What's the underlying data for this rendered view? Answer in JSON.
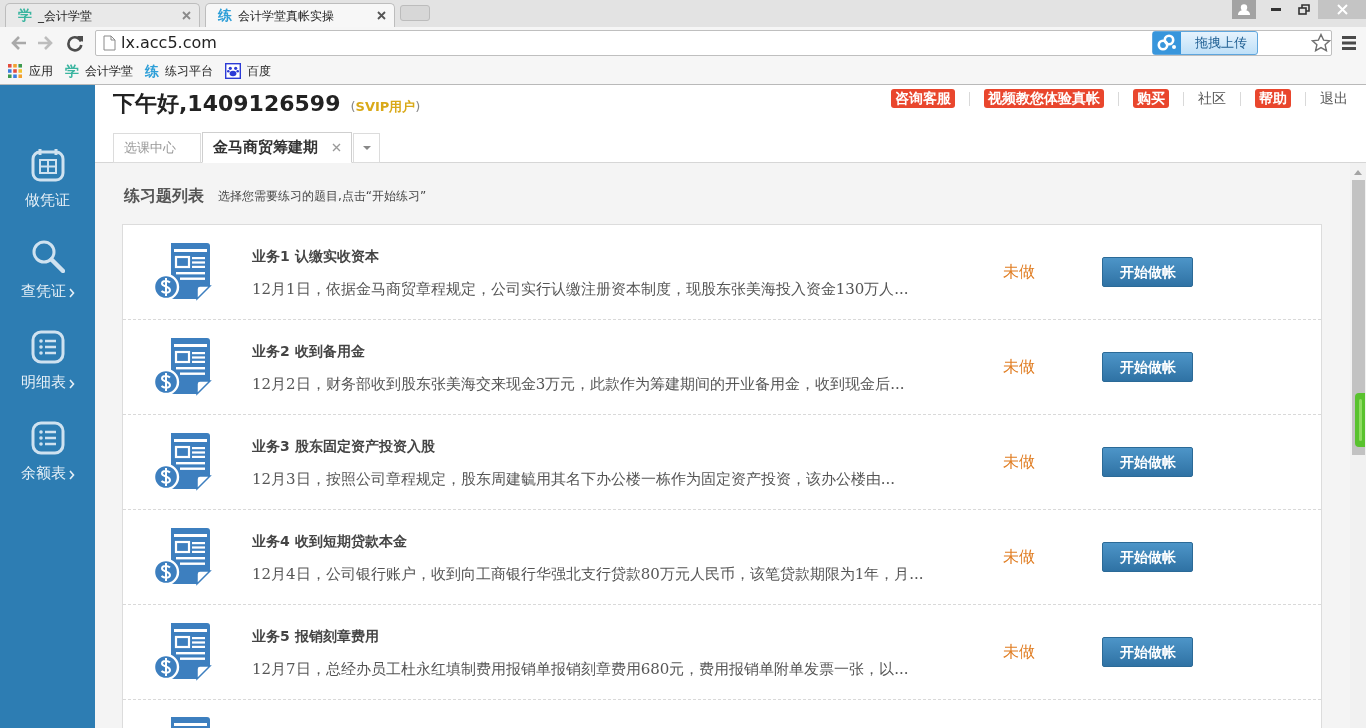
{
  "browser": {
    "tabs": [
      {
        "favicon": "学",
        "color": "#3bb5a0",
        "title": "_会计学堂",
        "selected": false
      },
      {
        "favicon": "练",
        "color": "#2e9fd8",
        "title": "会计学堂真帐实操",
        "selected": true
      }
    ],
    "address": "lx.acc5.com",
    "extension_button": "拖拽上传",
    "bookmarks": [
      {
        "kind": "apps",
        "label": "应用"
      },
      {
        "kind": "glyph",
        "glyph": "学",
        "color": "#3bb5a0",
        "label": "会计学堂"
      },
      {
        "kind": "glyph",
        "glyph": "练",
        "color": "#2e9fd8",
        "label": "练习平台"
      },
      {
        "kind": "paw",
        "label": "百度"
      }
    ]
  },
  "sidebar": {
    "items": [
      {
        "kind": "calendar",
        "label": "做凭证",
        "expandable": false
      },
      {
        "kind": "search",
        "label": "查凭证",
        "expandable": true
      },
      {
        "kind": "list",
        "label": "明细表",
        "expandable": true
      },
      {
        "kind": "list",
        "label": "余额表",
        "expandable": true
      }
    ]
  },
  "header": {
    "greeting": "下午好,1409126599",
    "membership": "(**SVIP用户**)",
    "links": [
      {
        "label": "咨询客服",
        "highlighted": true
      },
      {
        "label": "视频教您体验真帐",
        "highlighted": true
      },
      {
        "label": "购买",
        "highlighted": true
      },
      {
        "label": "社区",
        "highlighted": false
      },
      {
        "label": "帮助",
        "highlighted": true
      },
      {
        "label": "退出",
        "highlighted": false
      }
    ]
  },
  "page_tabs": [
    {
      "label": "选课中心",
      "selected": false,
      "closable": false
    },
    {
      "label": "金马商贸筹建期",
      "selected": true,
      "closable": true
    }
  ],
  "exercise_list": {
    "title": "练习题列表",
    "hint": "选择您需要练习的题目,点击“开始练习”",
    "rows": [
      {
        "title": "业务1 认缴实收资本",
        "description": "12月1日，依据金马商贸章程规定，公司实行认缴注册资本制度，现股东张美海投入资金130万人...",
        "status": "未做",
        "button": "开始做帐"
      },
      {
        "title": "业务2 收到备用金",
        "description": "12月2日，财务部收到股东张美海交来现金3万元，此款作为筹建期间的开业备用金，收到现金后...",
        "status": "未做",
        "button": "开始做帐"
      },
      {
        "title": "业务3 股东固定资产投资入股",
        "description": "12月3日，按照公司章程规定，股东周建毓用其名下办公楼一栋作为固定资产投资，该办公楼由...",
        "status": "未做",
        "button": "开始做帐"
      },
      {
        "title": "业务4 收到短期贷款本金",
        "description": "12月4日，公司银行账户，收到向工商银行华强北支行贷款80万元人民币，该笔贷款期限为1年，月...",
        "status": "未做",
        "button": "开始做帐"
      },
      {
        "title": "业务5 报销刻章费用",
        "description": "12月7日，总经办员工杜永红填制费用报销单报销刻章费用680元，费用报销单附单发票一张，以...",
        "status": "未做",
        "button": "开始做帐"
      }
    ]
  }
}
